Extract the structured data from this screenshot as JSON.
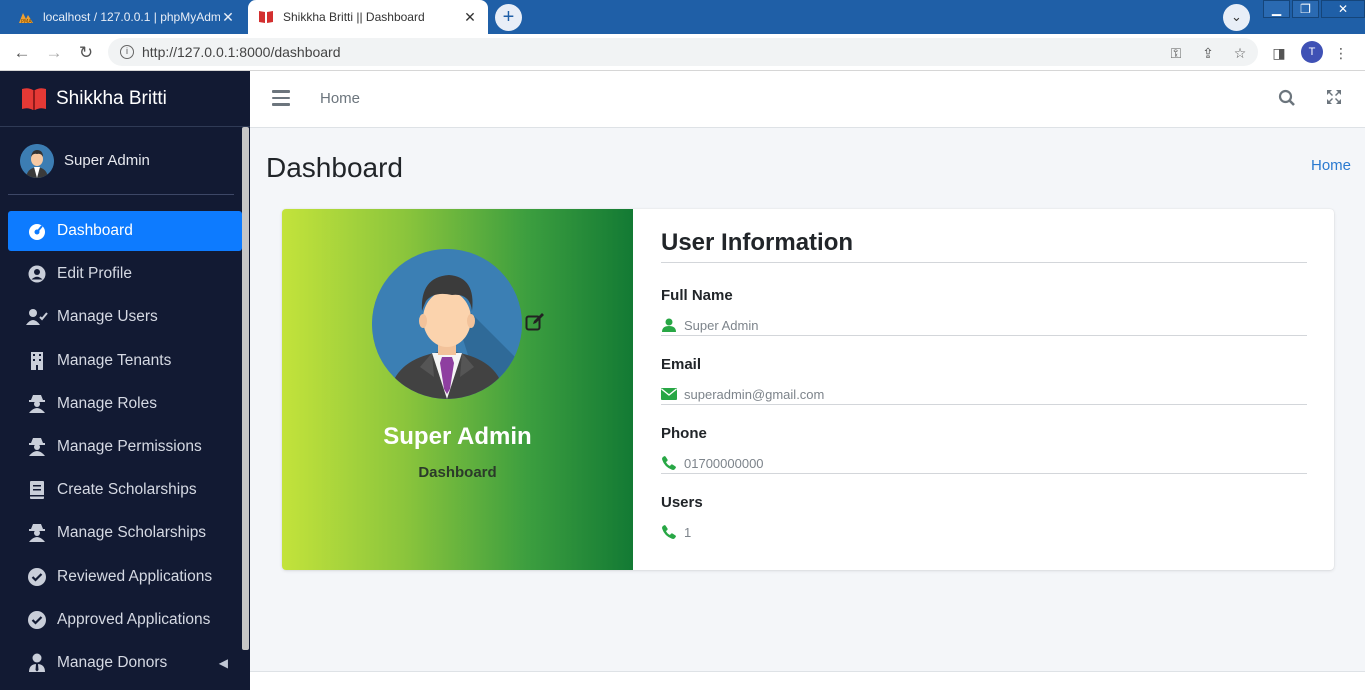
{
  "browser": {
    "tabs": [
      {
        "title": "localhost / 127.0.0.1 | phpMyAdmin",
        "active": false
      },
      {
        "title": "Shikkha Britti || Dashboard",
        "active": true
      }
    ],
    "new_tab": "+",
    "url": "http://127.0.0.1:8000/dashboard",
    "profile_initial": "T"
  },
  "sidebar": {
    "brand": "Shikkha Britti",
    "user_name": "Super Admin",
    "items": [
      {
        "label": "Dashboard",
        "icon": "dashboard-icon",
        "active": true
      },
      {
        "label": "Edit Profile",
        "icon": "user-circle-icon"
      },
      {
        "label": "Manage Users",
        "icon": "user-check-icon"
      },
      {
        "label": "Manage Tenants",
        "icon": "building-icon"
      },
      {
        "label": "Manage Roles",
        "icon": "user-secret-icon"
      },
      {
        "label": "Manage Permissions",
        "icon": "user-secret-icon"
      },
      {
        "label": "Create Scholarships",
        "icon": "book-icon"
      },
      {
        "label": "Manage Scholarships",
        "icon": "user-secret-icon"
      },
      {
        "label": "Reviewed Applications",
        "icon": "check-circle-icon"
      },
      {
        "label": "Approved Applications",
        "icon": "check-circle-icon"
      },
      {
        "label": "Manage Donors",
        "icon": "user-tie-icon",
        "caret": "◀"
      }
    ]
  },
  "topbar": {
    "home_link": "Home"
  },
  "page": {
    "title": "Dashboard",
    "breadcrumb": "Home"
  },
  "profile_card": {
    "name": "Super Admin",
    "role": "Dashboard",
    "info_title": "User Information",
    "fields": [
      {
        "label": "Full Name",
        "value": "Super Admin",
        "icon": "user-icon"
      },
      {
        "label": "Email",
        "value": "superadmin@gmail.com",
        "icon": "envelope-icon"
      },
      {
        "label": "Phone",
        "value": "01700000000",
        "icon": "phone-icon"
      },
      {
        "label": "Users",
        "value": "1",
        "icon": "phone-icon"
      }
    ]
  },
  "colors": {
    "sidebar_bg": "#121a33",
    "active_item": "#0d7bff",
    "icon_green": "#28a745",
    "link_blue": "#2a7ad0"
  }
}
